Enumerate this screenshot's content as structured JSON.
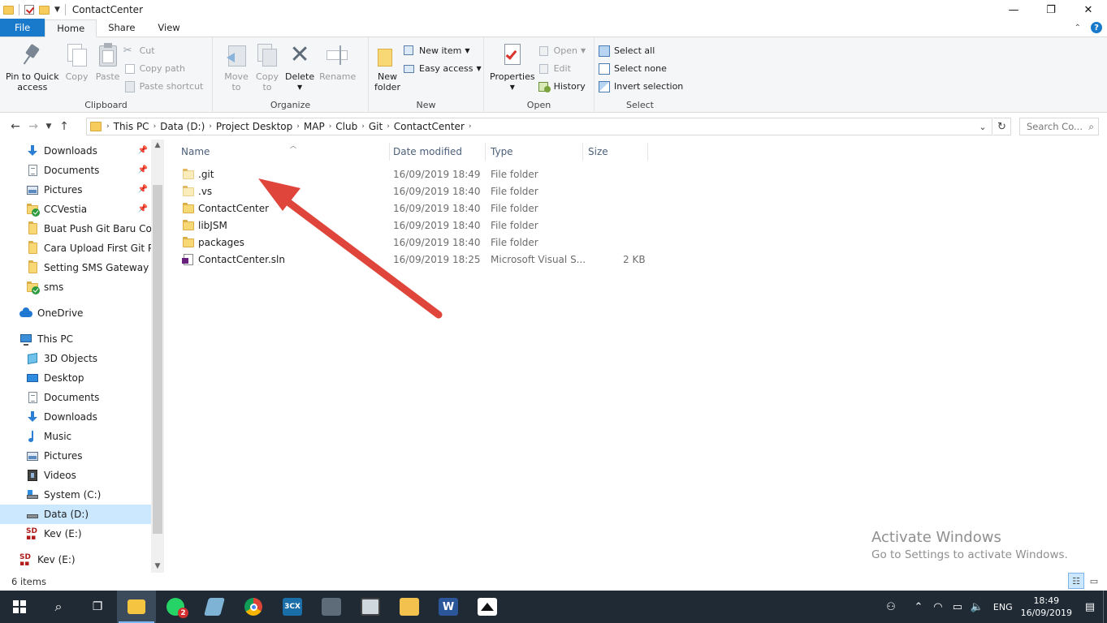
{
  "window": {
    "title": "ContactCenter",
    "controls": [
      "—",
      "❐",
      "✕"
    ]
  },
  "ribbon_tabs": [
    {
      "label": "File"
    },
    {
      "label": "Home"
    },
    {
      "label": "Share"
    },
    {
      "label": "View"
    }
  ],
  "ribbon": {
    "clipboard": {
      "label": "Clipboard",
      "pin_line1": "Pin to Quick",
      "pin_line2": "access",
      "copy": "Copy",
      "paste": "Paste",
      "cut": "Cut",
      "copy_path": "Copy path",
      "paste_shortcut": "Paste shortcut"
    },
    "organize": {
      "label": "Organize",
      "move_to_line1": "Move",
      "move_to_line2": "to",
      "copy_to_line1": "Copy",
      "copy_to_line2": "to",
      "delete": "Delete",
      "rename": "Rename"
    },
    "new": {
      "label": "New",
      "new_folder_line1": "New",
      "new_folder_line2": "folder",
      "new_item": "New item",
      "easy_access": "Easy access"
    },
    "open": {
      "label": "Open",
      "properties": "Properties",
      "open": "Open",
      "edit": "Edit",
      "history": "History"
    },
    "select": {
      "label": "Select",
      "select_all": "Select all",
      "select_none": "Select none",
      "invert_selection": "Invert selection"
    }
  },
  "address": {
    "crumbs": [
      "This PC",
      "Data (D:)",
      "Project Desktop",
      "MAP",
      "Club",
      "Git",
      "ContactCenter"
    ],
    "search_placeholder": "Search Co..."
  },
  "nav_pane": {
    "quick_access": [
      {
        "label": "Downloads",
        "icon": "download-icon",
        "pinned": true
      },
      {
        "label": "Documents",
        "icon": "documents-icon",
        "pinned": true
      },
      {
        "label": "Pictures",
        "icon": "pictures-icon",
        "pinned": true
      },
      {
        "label": "CCVestia",
        "icon": "folder-synced-icon",
        "pinned": true
      },
      {
        "label": "Buat Push Git Baru Comr",
        "icon": "folder-icon",
        "pinned": false
      },
      {
        "label": "Cara Upload First Git Proj",
        "icon": "folder-icon",
        "pinned": false
      },
      {
        "label": "Setting SMS Gateway",
        "icon": "folder-icon",
        "pinned": false
      },
      {
        "label": "sms",
        "icon": "folder-synced-icon",
        "pinned": false
      }
    ],
    "onedrive": "OneDrive",
    "this_pc": "This PC",
    "this_pc_items": [
      {
        "label": "3D Objects",
        "icon": "3d-objects-icon"
      },
      {
        "label": "Desktop",
        "icon": "desktop-icon"
      },
      {
        "label": "Documents",
        "icon": "documents-icon"
      },
      {
        "label": "Downloads",
        "icon": "download-icon"
      },
      {
        "label": "Music",
        "icon": "music-icon"
      },
      {
        "label": "Pictures",
        "icon": "pictures-icon"
      },
      {
        "label": "Videos",
        "icon": "videos-icon"
      },
      {
        "label": "System (C:)",
        "icon": "system-drive-icon"
      },
      {
        "label": "Data (D:)",
        "icon": "drive-icon",
        "selected": true
      },
      {
        "label": "Kev (E:)",
        "icon": "sd-card-icon"
      }
    ],
    "kev_drive": "Kev (E:)"
  },
  "file_list": {
    "columns": [
      "Name",
      "Date modified",
      "Type",
      "Size"
    ],
    "rows": [
      {
        "name": ".git",
        "date": "16/09/2019 18:49",
        "type": "File folder",
        "size": "",
        "icon": "folder-hidden-icon"
      },
      {
        "name": ".vs",
        "date": "16/09/2019 18:40",
        "type": "File folder",
        "size": "",
        "icon": "folder-hidden-icon"
      },
      {
        "name": "ContactCenter",
        "date": "16/09/2019 18:40",
        "type": "File folder",
        "size": "",
        "icon": "folder-icon"
      },
      {
        "name": "libJSM",
        "date": "16/09/2019 18:40",
        "type": "File folder",
        "size": "",
        "icon": "folder-icon"
      },
      {
        "name": "packages",
        "date": "16/09/2019 18:40",
        "type": "File folder",
        "size": "",
        "icon": "folder-icon"
      },
      {
        "name": "ContactCenter.sln",
        "date": "16/09/2019 18:25",
        "type": "Microsoft Visual S...",
        "size": "2 KB",
        "icon": "visual-studio-solution-icon"
      }
    ]
  },
  "watermark": {
    "line1": "Activate Windows",
    "line2": "Go to Settings to activate Windows."
  },
  "status": {
    "item_count": "6 items"
  },
  "taskbar": {
    "whatsapp_badge": "2",
    "app_3cx": "3CX",
    "lang": "ENG",
    "time": "18:49",
    "date": "16/09/2019"
  },
  "colors": {
    "file_tab": "#1979ca",
    "selection": "#cce8ff",
    "arrow": "#e0453c",
    "taskbar": "#1f2a35"
  }
}
